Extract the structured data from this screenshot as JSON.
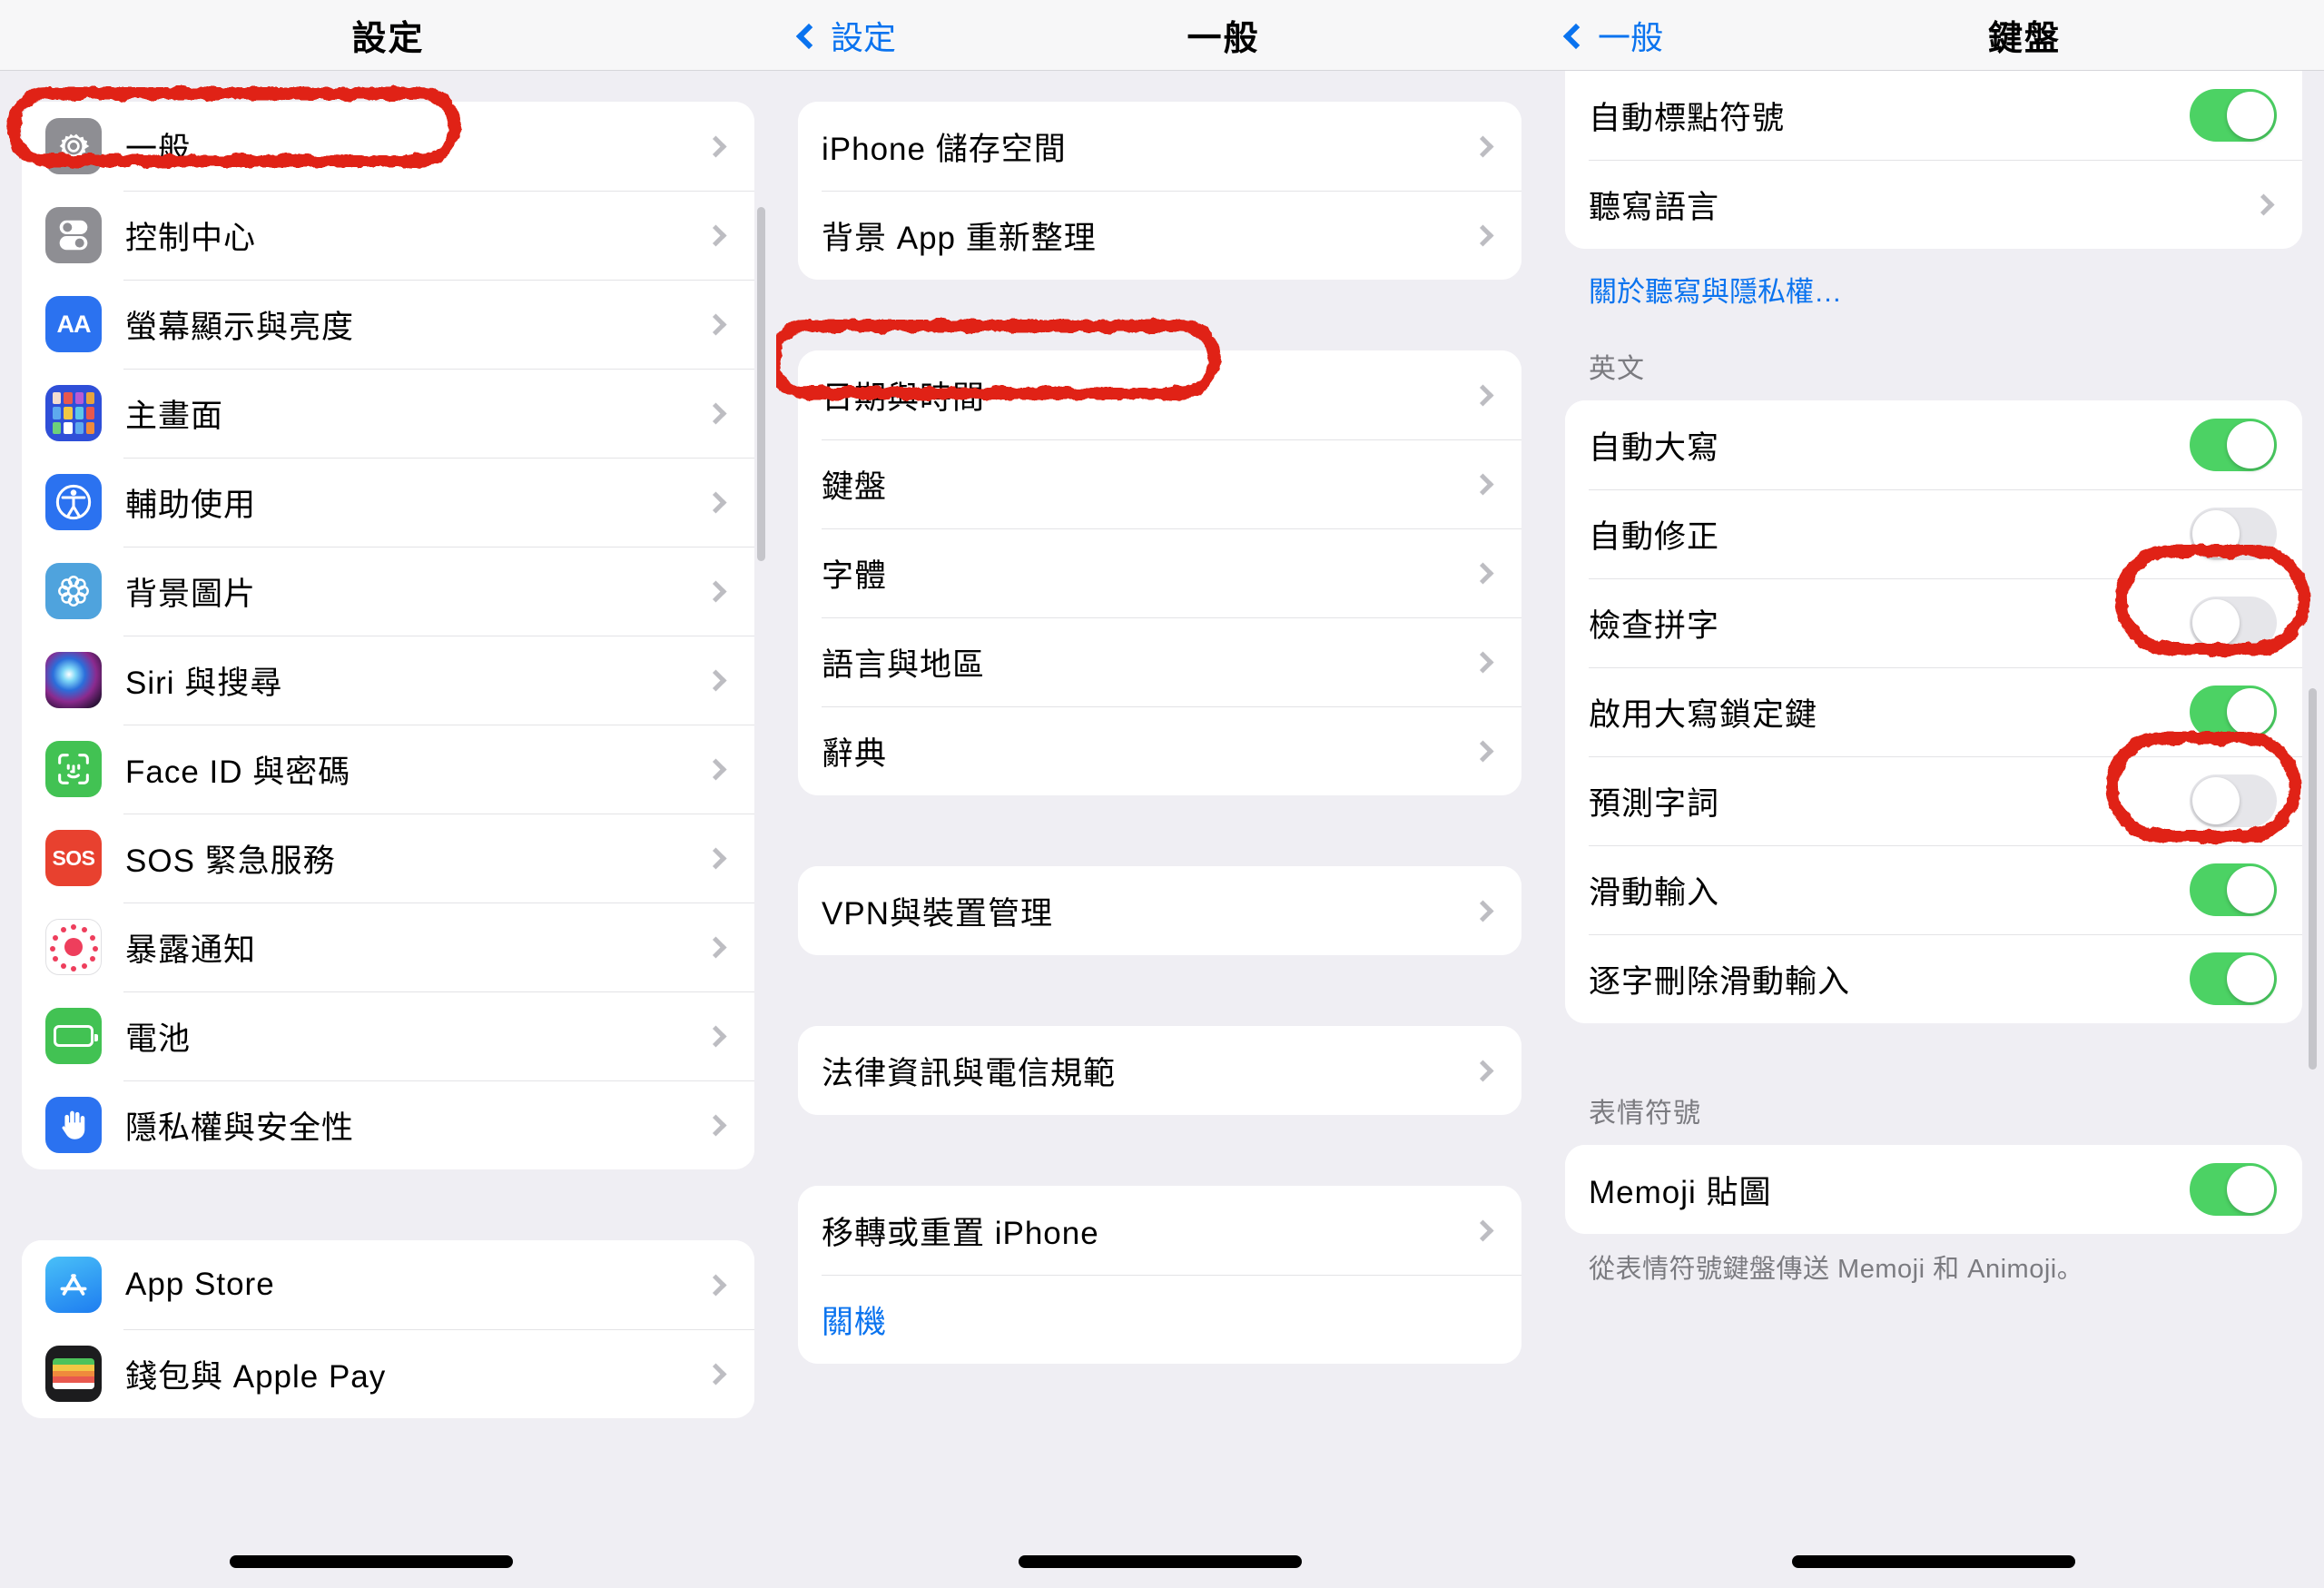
{
  "panels": {
    "settings": {
      "title": "設定",
      "groups": [
        {
          "items": [
            {
              "label": "一般",
              "icon": "gear-icon",
              "highlighted": true
            },
            {
              "label": "控制中心",
              "icon": "control-center-icon"
            },
            {
              "label": "螢幕顯示與亮度",
              "icon": "display-brightness-icon"
            },
            {
              "label": "主畫面",
              "icon": "home-screen-icon"
            },
            {
              "label": "輔助使用",
              "icon": "accessibility-icon"
            },
            {
              "label": "背景圖片",
              "icon": "wallpaper-icon"
            },
            {
              "label": "Siri 與搜尋",
              "icon": "siri-icon"
            },
            {
              "label": "Face ID 與密碼",
              "icon": "face-id-icon"
            },
            {
              "label": "SOS 緊急服務",
              "icon": "sos-icon"
            },
            {
              "label": "暴露通知",
              "icon": "exposure-notification-icon"
            },
            {
              "label": "電池",
              "icon": "battery-icon"
            },
            {
              "label": "隱私權與安全性",
              "icon": "privacy-hand-icon"
            }
          ]
        },
        {
          "items": [
            {
              "label": "App Store",
              "icon": "app-store-icon"
            },
            {
              "label": "錢包與 Apple Pay",
              "icon": "wallet-icon"
            }
          ]
        }
      ]
    },
    "general": {
      "title": "一般",
      "back_label": "設定",
      "groups": [
        {
          "items": [
            {
              "label": "iPhone 儲存空間"
            },
            {
              "label": "背景 App 重新整理"
            }
          ]
        },
        {
          "items": [
            {
              "label": "日期與時間"
            },
            {
              "label": "鍵盤",
              "highlighted": true
            },
            {
              "label": "字體"
            },
            {
              "label": "語言與地區"
            },
            {
              "label": "辭典"
            }
          ]
        },
        {
          "items": [
            {
              "label": "VPN與裝置管理"
            }
          ]
        },
        {
          "items": [
            {
              "label": "法律資訊與電信規範"
            }
          ]
        },
        {
          "items": [
            {
              "label": "移轉或重置 iPhone"
            },
            {
              "label": "關機",
              "is_link": true
            }
          ]
        }
      ]
    },
    "keyboard": {
      "title": "鍵盤",
      "back_label": "一般",
      "group_dictation": {
        "items": [
          {
            "label": "自動標點符號",
            "type": "toggle",
            "value": "on"
          },
          {
            "label": "聽寫語言",
            "type": "chevron"
          }
        ]
      },
      "dictation_privacy_link": "關於聽寫與隱私權…",
      "english_section": {
        "header": "英文",
        "items": [
          {
            "label": "自動大寫",
            "type": "toggle",
            "value": "on"
          },
          {
            "label": "自動修正",
            "type": "toggle",
            "value": "off",
            "highlighted": true
          },
          {
            "label": "檢查拼字",
            "type": "toggle",
            "value": "off"
          },
          {
            "label": "啟用大寫鎖定鍵",
            "type": "toggle",
            "value": "on"
          },
          {
            "label": "預測字詞",
            "type": "toggle",
            "value": "off",
            "highlighted": true
          },
          {
            "label": "滑動輸入",
            "type": "toggle",
            "value": "on"
          },
          {
            "label": "逐字刪除滑動輸入",
            "type": "toggle",
            "value": "on"
          }
        ]
      },
      "emoji_section": {
        "header": "表情符號",
        "items": [
          {
            "label": "Memoji 貼圖",
            "type": "toggle",
            "value": "on"
          }
        ],
        "footer": "從表情符號鍵盤傳送 Memoji 和 Animoji。"
      }
    }
  },
  "colors": {
    "accent_blue": "#0a73ef",
    "toggle_on_green": "#4cd264",
    "toggle_off_gray": "#e6e6ea",
    "annotation_red": "#e02315",
    "background": "#efeef3"
  }
}
